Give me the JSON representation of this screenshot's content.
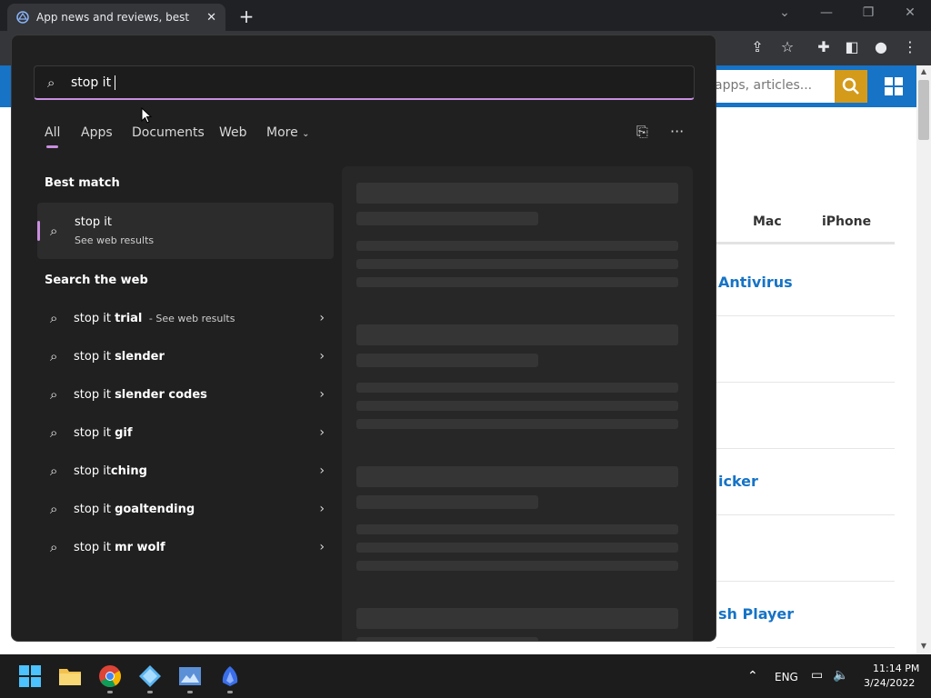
{
  "browser": {
    "tab_title": "App news and reviews, best software downloads and discounts",
    "tab_close": "✕",
    "new_tab": "+",
    "window_controls": {
      "dropdown": "⌄",
      "minimize": "—",
      "restore": "❐",
      "close": "✕"
    },
    "toolbar_icons": [
      "share-icon",
      "star-icon",
      "extensions-icon",
      "sidebar-icon",
      "profile-icon",
      "menu-icon"
    ]
  },
  "website": {
    "search_placeholder": "apps, articles...",
    "tabs": [
      "Mac",
      "iPhone"
    ],
    "items": [
      "Antivirus",
      "icker",
      "sh Player"
    ]
  },
  "search_panel": {
    "query": "stop it",
    "filters": [
      "All",
      "Apps",
      "Documents",
      "Web",
      "More"
    ],
    "active_filter": "All",
    "best_match_title": "Best match",
    "best_match": {
      "title": "stop it",
      "subtitle": "See web results"
    },
    "search_web_title": "Search the web",
    "web_results": [
      {
        "prefix": "stop it ",
        "bold": "trial",
        "note": " - See web results"
      },
      {
        "prefix": "stop it ",
        "bold": "slender",
        "note": ""
      },
      {
        "prefix": "stop it ",
        "bold": "slender codes",
        "note": ""
      },
      {
        "prefix": "stop it ",
        "bold": "gif",
        "note": ""
      },
      {
        "prefix": "stop it",
        "bold": "ching",
        "note": ""
      },
      {
        "prefix": "stop it ",
        "bold": "goaltending",
        "note": ""
      },
      {
        "prefix": "stop it ",
        "bold": "mr wolf",
        "note": ""
      }
    ],
    "accent_color": "#c98ee0"
  },
  "taskbar": {
    "apps": [
      "windows-start-icon",
      "file-explorer-icon",
      "chrome-icon",
      "diamond-app-icon",
      "image-app-icon",
      "bird-app-icon"
    ],
    "language": "ENG",
    "time": "11:14 PM",
    "date": "3/24/2022"
  }
}
